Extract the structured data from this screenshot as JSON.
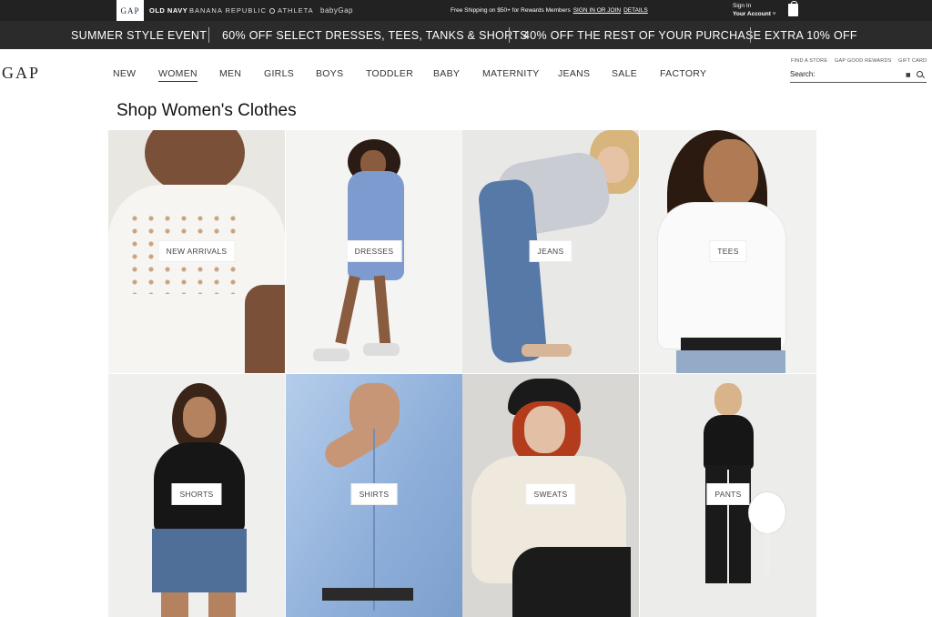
{
  "brands": {
    "gap": "GAP",
    "old_navy": "OLD NAVY",
    "banana_republic": "BANANA REPUBLIC",
    "athleta": "ATHLETA",
    "babygap": "babyGap"
  },
  "top_promo": {
    "text": "Free Shipping on $50+ for Rewards Members",
    "signin_link": "SIGN IN OR JOIN",
    "details_link": "DETAILS"
  },
  "account": {
    "line1": "Sign In",
    "line2": "Your Account"
  },
  "promo_bar": {
    "items": [
      "SUMMER STYLE EVENT",
      "60% OFF SELECT DRESSES, TEES, TANKS & SHORTS",
      "40% OFF THE REST OF YOUR PURCHASE",
      "EXTRA 10% OFF"
    ]
  },
  "logo": "GAP",
  "nav": {
    "items": [
      "NEW",
      "WOMEN",
      "MEN",
      "GIRLS",
      "BOYS",
      "TODDLER",
      "BABY",
      "MATERNITY",
      "JEANS",
      "SALE",
      "FACTORY"
    ],
    "active": "WOMEN"
  },
  "utility_links": [
    "FIND A STORE",
    "GAP GOOD REWARDS",
    "GIFT CARD"
  ],
  "search": {
    "label": "Search:",
    "value": "",
    "placeholder": ""
  },
  "page_title": "Shop Women's Clothes",
  "categories": [
    "NEW ARRIVALS",
    "DRESSES",
    "JEANS",
    "TEES",
    "SHORTS",
    "SHIRTS",
    "SWEATS",
    "PANTS"
  ]
}
